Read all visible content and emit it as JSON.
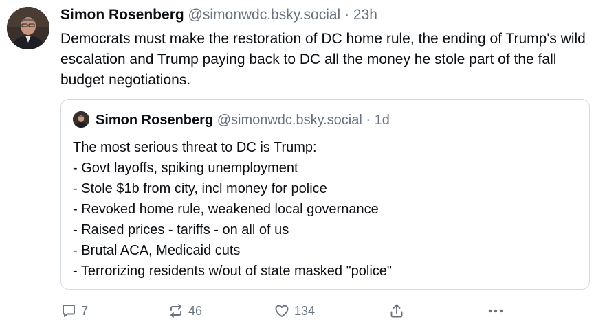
{
  "post": {
    "author_name": "Simon Rosenberg",
    "author_handle": "@simonwdc.bsky.social",
    "separator": "·",
    "time": "23h",
    "text": "Democrats must make the restoration of DC home rule, the ending of Trump's wild escalation and Trump paying back to DC all the money he stole part of the fall budget negotiations."
  },
  "quote": {
    "author_name": "Simon Rosenberg",
    "author_handle": "@simonwdc.bsky.social",
    "separator": "·",
    "time": "1d",
    "lines": [
      "The most serious threat to DC is Trump:",
      "- Govt layoffs, spiking unemployment",
      "- Stole $1b from city, incl money for police",
      "- Revoked home rule, weakened local governance",
      "- Raised prices - tariffs - on all of us",
      "- Brutal ACA, Medicaid cuts",
      "- Terrorizing residents w/out of state masked \"police\""
    ]
  },
  "actions": {
    "reply_icon": "comment-bubble-icon",
    "reply_count": "7",
    "repost_icon": "repost-arrows-icon",
    "repost_count": "46",
    "like_icon": "heart-icon",
    "like_count": "134",
    "share_icon": "share-upload-icon",
    "more_icon": "more-dots-icon"
  },
  "colors": {
    "text": "#0b0f14",
    "muted": "#66727f",
    "border": "#d4dbe2",
    "background": "#ffffff"
  }
}
